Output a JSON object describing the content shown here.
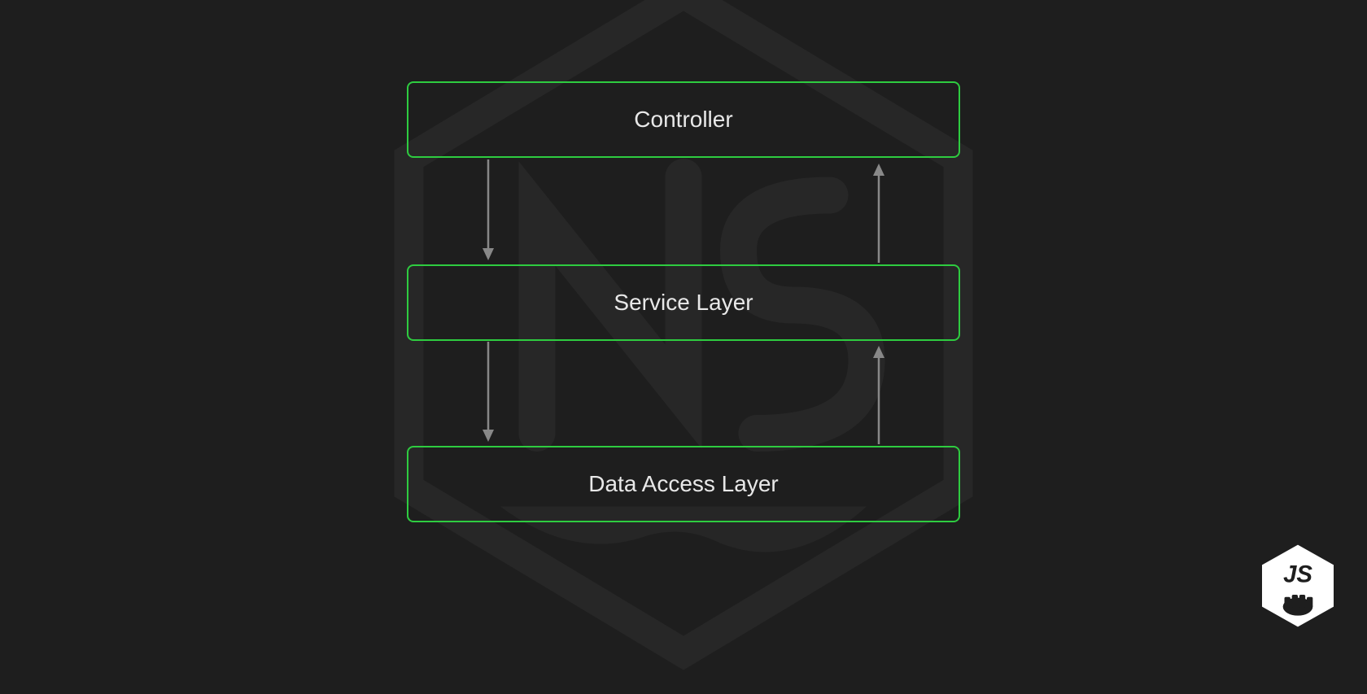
{
  "diagram": {
    "layers": [
      {
        "id": "controller",
        "label": "Controller"
      },
      {
        "id": "service",
        "label": "Service Layer"
      },
      {
        "id": "data-access",
        "label": "Data Access Layer"
      }
    ],
    "arrows": [
      {
        "from": "controller",
        "to": "service",
        "direction": "down"
      },
      {
        "from": "service",
        "to": "controller",
        "direction": "up"
      },
      {
        "from": "service",
        "to": "data-access",
        "direction": "down"
      },
      {
        "from": "data-access",
        "to": "service",
        "direction": "up"
      }
    ],
    "colors": {
      "background": "#1e1e1e",
      "boxBorder": "#2ecc40",
      "text": "#e8e8e8",
      "arrow": "#888888"
    }
  }
}
